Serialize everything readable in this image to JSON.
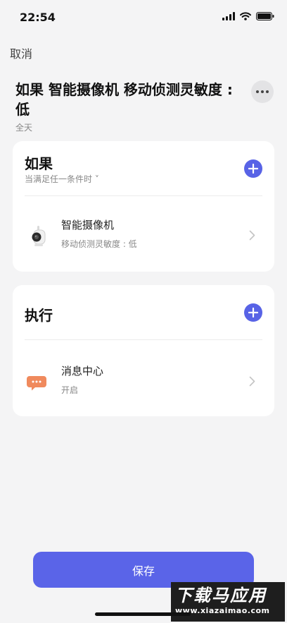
{
  "status_bar": {
    "time": "22:54"
  },
  "header": {
    "cancel_label": "取消",
    "title": "如果 智能摄像机 移动侦测灵敏度 : 低",
    "subtitle": "全天"
  },
  "condition_card": {
    "title": "如果",
    "subtitle": "当满足任一条件时 ˅",
    "items": [
      {
        "title": "智能摄像机",
        "description": "移动侦测灵敏度 : 低",
        "icon": "smart-camera-icon"
      }
    ]
  },
  "action_card": {
    "title": "执行",
    "items": [
      {
        "title": "消息中心",
        "description": "开启",
        "icon": "message-center-icon"
      }
    ]
  },
  "footer": {
    "save_label": "保存"
  },
  "watermark": {
    "text": "下载马应用",
    "url": "www.xiazaimao.com"
  },
  "colors": {
    "accent": "#5a64e8",
    "message_icon": "#f08a5d",
    "background": "#f4f4f5"
  }
}
